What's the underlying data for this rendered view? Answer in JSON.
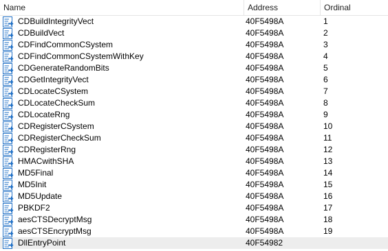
{
  "columns": {
    "name": "Name",
    "address": "Address",
    "ordinal": "Ordinal"
  },
  "icon": "export-function-icon",
  "colors": {
    "icon_blue": "#1f6fc5",
    "selected_row": "#ededed",
    "header_divider": "#e5e5e5"
  },
  "rows": [
    {
      "name": "CDBuildIntegrityVect",
      "address": "40F5498A",
      "ordinal": "1"
    },
    {
      "name": "CDBuildVect",
      "address": "40F5498A",
      "ordinal": "2"
    },
    {
      "name": "CDFindCommonCSystem",
      "address": "40F5498A",
      "ordinal": "3"
    },
    {
      "name": "CDFindCommonCSystemWithKey",
      "address": "40F5498A",
      "ordinal": "4"
    },
    {
      "name": "CDGenerateRandomBits",
      "address": "40F5498A",
      "ordinal": "5"
    },
    {
      "name": "CDGetIntegrityVect",
      "address": "40F5498A",
      "ordinal": "6"
    },
    {
      "name": "CDLocateCSystem",
      "address": "40F5498A",
      "ordinal": "7"
    },
    {
      "name": "CDLocateCheckSum",
      "address": "40F5498A",
      "ordinal": "8"
    },
    {
      "name": "CDLocateRng",
      "address": "40F5498A",
      "ordinal": "9"
    },
    {
      "name": "CDRegisterCSystem",
      "address": "40F5498A",
      "ordinal": "10"
    },
    {
      "name": "CDRegisterCheckSum",
      "address": "40F5498A",
      "ordinal": "11"
    },
    {
      "name": "CDRegisterRng",
      "address": "40F5498A",
      "ordinal": "12"
    },
    {
      "name": "HMACwithSHA",
      "address": "40F5498A",
      "ordinal": "13"
    },
    {
      "name": "MD5Final",
      "address": "40F5498A",
      "ordinal": "14"
    },
    {
      "name": "MD5Init",
      "address": "40F5498A",
      "ordinal": "15"
    },
    {
      "name": "MD5Update",
      "address": "40F5498A",
      "ordinal": "16"
    },
    {
      "name": "PBKDF2",
      "address": "40F5498A",
      "ordinal": "17"
    },
    {
      "name": "aesCTSDecryptMsg",
      "address": "40F5498A",
      "ordinal": "18"
    },
    {
      "name": "aesCTSEncryptMsg",
      "address": "40F5498A",
      "ordinal": "19"
    },
    {
      "name": "DllEntryPoint",
      "address": "40F54982",
      "ordinal": "",
      "selected": true
    }
  ]
}
